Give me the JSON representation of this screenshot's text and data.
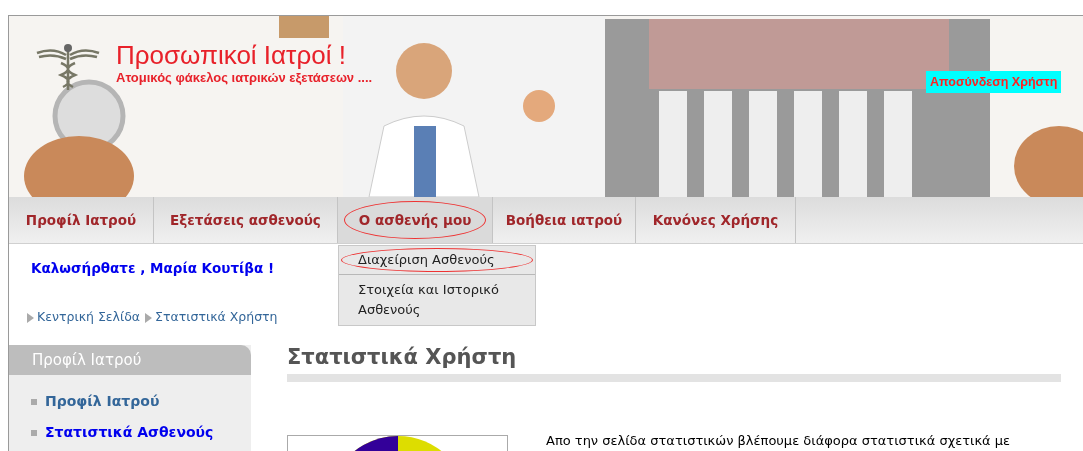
{
  "header": {
    "title": "Προσωπικοί Ιατροί !",
    "subtitle": "Ατομικός φάκελος ιατρικών εξετάσεων ....",
    "logout_button": "Αποσύνδεση Χρήστη"
  },
  "nav_tabs": [
    {
      "label": "Προφίλ Ιατρού",
      "selected": false
    },
    {
      "label": "Εξετάσεις ασθενούς",
      "selected": false
    },
    {
      "label": "Ο ασθενής μου",
      "selected": true,
      "expanded": true,
      "menu": [
        {
          "label": "Διαχείριση Ασθενούς",
          "selected": true
        },
        {
          "label": "Στοιχεία και Ιστορικό Ασθενούς",
          "selected": false
        }
      ]
    },
    {
      "label": "Βοήθεια ιατρού",
      "selected": false
    },
    {
      "label": "Κανόνες Χρήσης",
      "selected": false
    }
  ],
  "welcome": "Καλωσήρθατε , Μαρία Κουτίβα !",
  "breadcrumb": [
    "Κεντρική Σελίδα",
    "Στατιστικά Χρήστη"
  ],
  "sidebar": {
    "title": "Προφίλ Ιατρού",
    "items": [
      {
        "label": "Προφίλ Ιατρού",
        "selected": false
      },
      {
        "label": "Στατιστικά Ασθενούς",
        "selected": true
      }
    ]
  },
  "main": {
    "heading": "Στατιστικά Χρήστη",
    "intro": "Απο την σελίδα στατιστικών βλέπουμε διάφορα στατιστικά σχετικά με"
  }
}
